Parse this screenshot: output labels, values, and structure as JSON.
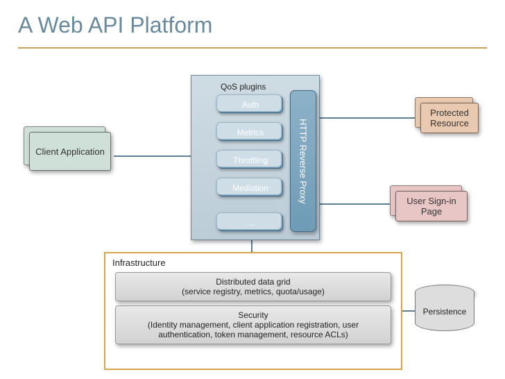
{
  "title": "A Web API Platform",
  "client": "Client Application",
  "qosHeader": "QoS plugins",
  "plugins": {
    "auth": "Auth",
    "metrics": "Metrics",
    "throttling": "Throttling",
    "mediation": "Mediation",
    "more": "…"
  },
  "proxy": "HTTP Reverse Proxy",
  "protected": "Protected Resource",
  "signin": "User Sign-in Page",
  "infra": {
    "title": "Infrastructure",
    "grid": "Distributed data grid\n(service registry, metrics, quota/usage)",
    "security": "Security\n(Identity management, client application registration, user authentication, token management, resource ACLs)"
  },
  "persistence": "Persistence"
}
